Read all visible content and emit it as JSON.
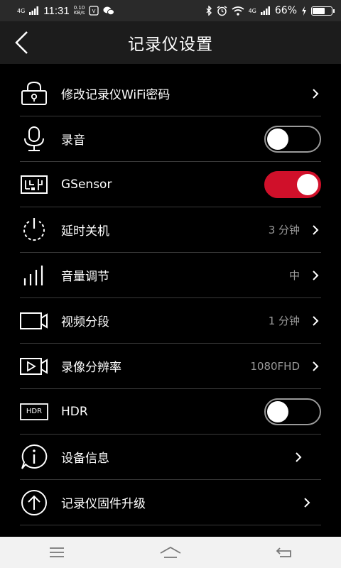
{
  "status_bar": {
    "network": "4G",
    "time": "11:31",
    "speed_value": "0.10",
    "speed_unit": "KB/s",
    "network_right": "4G",
    "battery": "66%",
    "battery_level": 0.66
  },
  "header": {
    "title": "记录仪设置"
  },
  "settings": {
    "wifi_password": {
      "label": "修改记录仪WiFi密码"
    },
    "audio": {
      "label": "录音",
      "enabled": false
    },
    "gsensor": {
      "label": "GSensor",
      "enabled": true
    },
    "delay_shutdown": {
      "label": "延时关机",
      "value": "3 分钟"
    },
    "volume": {
      "label": "音量调节",
      "value": "中"
    },
    "video_segment": {
      "label": "视频分段",
      "value": "1 分钟"
    },
    "resolution": {
      "label": "录像分辨率",
      "value": "1080FHD"
    },
    "hdr": {
      "label": "HDR",
      "enabled": false,
      "icon_text": "HDR"
    },
    "device_info": {
      "label": "设备信息"
    },
    "firmware": {
      "label": "记录仪固件升级"
    }
  },
  "colors": {
    "accent": "#d0102a",
    "background": "#000000",
    "header_bg": "#1c1c1c",
    "divider": "#3a3a3a",
    "secondary_text": "#9a9a9a"
  }
}
